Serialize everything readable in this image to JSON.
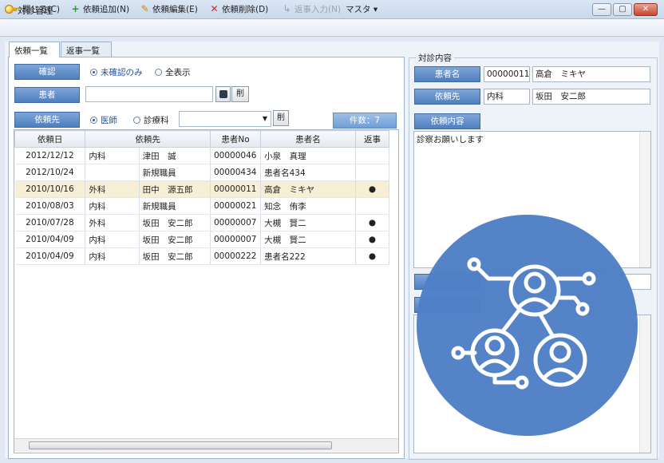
{
  "window": {
    "title": "対診管理",
    "minimize": "—",
    "maximize": "▢",
    "close": "✕"
  },
  "toolbar": {
    "close": "閉じる(C)",
    "add": "依頼追加(N)",
    "edit": "依頼編集(E)",
    "delete": "依頼削除(D)",
    "reply": "返事入力(N)",
    "master": "マスタ ▾"
  },
  "tabs": {
    "list": "依頼一覧",
    "reply": "返事一覧"
  },
  "filters": {
    "confirm_label": "確認",
    "unconfirmed": "未確認のみ",
    "all": "全表示",
    "patient_label": "患者",
    "patient_value": "",
    "clear": "削",
    "dest_label": "依頼先",
    "doctor": "医師",
    "dept": "診療科",
    "dept_value": "",
    "count": "件数：7"
  },
  "table": {
    "headers": [
      "依頼日",
      "依頼先",
      "",
      "患者No",
      "患者名",
      "返事"
    ],
    "rows": [
      {
        "date": "2012/12/12",
        "dept": "内科",
        "doctor": "津田　誠",
        "no": "00000046",
        "name": "小泉　真理",
        "reply": ""
      },
      {
        "date": "2012/10/24",
        "dept": "",
        "doctor": "新規職員",
        "no": "00000434",
        "name": "患者名434",
        "reply": ""
      },
      {
        "date": "2010/10/16",
        "dept": "外科",
        "doctor": "田中　源五郎",
        "no": "00000011",
        "name": "高倉　ミキヤ",
        "reply": "●"
      },
      {
        "date": "2010/08/03",
        "dept": "内科",
        "doctor": "新規職員",
        "no": "00000021",
        "name": "知念　侑李",
        "reply": ""
      },
      {
        "date": "2010/07/28",
        "dept": "外科",
        "doctor": "坂田　安二郎",
        "no": "00000007",
        "name": "大槻　賢二",
        "reply": "●"
      },
      {
        "date": "2010/04/09",
        "dept": "内科",
        "doctor": "坂田　安二郎",
        "no": "00000007",
        "name": "大槻　賢二",
        "reply": "●"
      },
      {
        "date": "2010/04/09",
        "dept": "内科",
        "doctor": "坂田　安二郎",
        "no": "00000222",
        "name": "患者名222",
        "reply": "●"
      }
    ]
  },
  "detail": {
    "group_title": "対診内容",
    "patient_label": "患者名",
    "patient_no": "00000011",
    "patient_name": "高倉　ミキヤ",
    "dest_label": "依頼先",
    "dest_dept": "内科",
    "dest_doctor": "坂田　安二郎",
    "content_label": "依頼内容",
    "content": "診察お願いします"
  },
  "colors": {
    "accent": "#4e7fc0",
    "overlay": "#4f7fc6",
    "selected_row": "#f6efd6"
  },
  "overlay_icon": "network-people-icon"
}
